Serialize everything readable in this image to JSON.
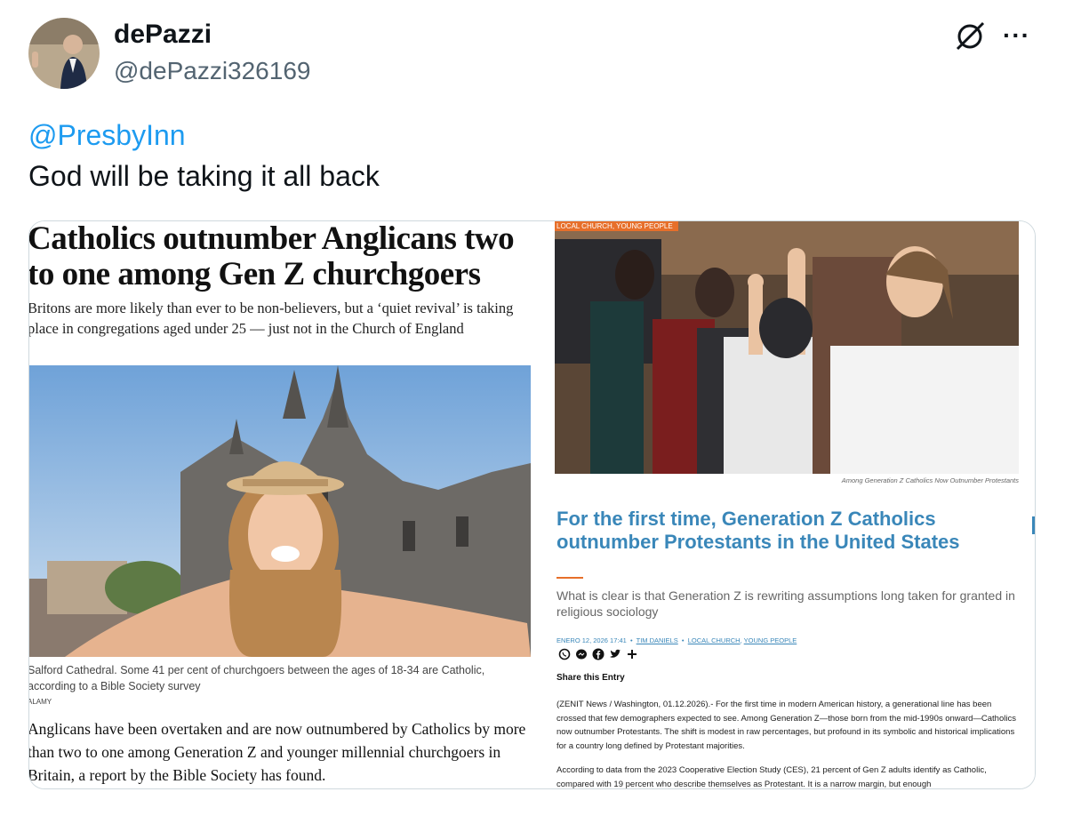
{
  "author": {
    "display_name": "dePazzi",
    "handle": "@dePazzi326169"
  },
  "tweet": {
    "mention": "@PresbyInn",
    "text": "God will be taking it all back"
  },
  "icons": [
    "grok-icon",
    "more-icon",
    "whatsapp-icon",
    "messenger-icon",
    "facebook-icon",
    "twitter-icon",
    "plus-icon"
  ],
  "left_article": {
    "headline": "Catholics outnumber Anglicans two to one among Gen Z churchgoers",
    "standfirst": "Britons are more likely than ever to be non-believers, but a ‘quiet revival’ is taking place in congregations aged under 25 — just not in the Church of England",
    "caption": "Salford Cathedral. Some 41 per cent of churchgoers between the ages of 18-34 are Catholic, according to a Bible Society survey",
    "credit": "ALAMY",
    "body": "Anglicans have been overtaken and are now outnumbered by Catholics by more than two to one among Generation Z and younger millennial churchgoers in Britain, a report by the Bible Society has found."
  },
  "right_article": {
    "category_tag": "LOCAL CHURCH, YOUNG PEOPLE",
    "photo_caption": "Among Generation Z Catholics Now Outnumber Protestants",
    "title": "For the first time, Generation Z Catholics outnumber Protestants in the United States",
    "lead": "What is clear is that Generation Z is rewriting assumptions long taken for granted in religious sociology",
    "meta_date": "ENERO 12, 2026 17:41",
    "meta_author": "TIM DANIELS",
    "meta_cat1": "LOCAL CHURCH",
    "meta_cat2": "YOUNG PEOPLE",
    "share_label": "Share this Entry",
    "body1": "(ZENIT News / Washington, 01.12.2026).- For the first time in modern American history, a generational line has been crossed that few demographers expected to see. Among Generation Z—those born from the mid-1990s onward—Catholics now outnumber Protestants. The shift is modest in raw percentages, but profound in its symbolic and historical implications for a country long defined by Protestant majorities.",
    "body2": "According to data from the 2023 Cooperative Election Study (CES), 21 percent of Gen Z adults identify as Catholic, compared with 19 percent who describe themselves as Protestant. It is a narrow margin, but enough"
  }
}
